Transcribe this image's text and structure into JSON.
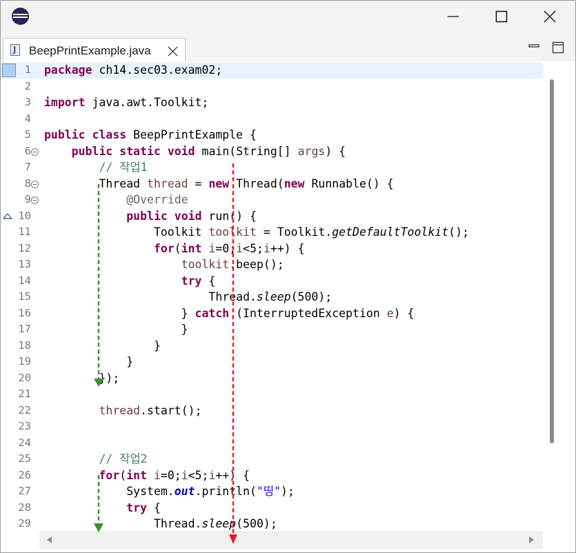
{
  "window": {
    "minimize_icon": "minimize-icon",
    "maximize_icon": "maximize-icon",
    "close_icon": "close-icon"
  },
  "tab": {
    "label": "BeepPrintExample.java",
    "icon": "java-file-icon",
    "close_icon": "close-icon"
  },
  "view_controls": {
    "minimize_icon": "minimize-icon",
    "maximize_icon": "maximize-icon"
  },
  "editor": {
    "current_line": 1,
    "lines": [
      {
        "n": "1",
        "tokens": [
          {
            "t": "package",
            "c": "kw"
          },
          {
            "t": " ch14.sec03.exam02;"
          }
        ]
      },
      {
        "n": "2",
        "tokens": []
      },
      {
        "n": "3",
        "tokens": [
          {
            "t": "import",
            "c": "kw"
          },
          {
            "t": " java.awt.Toolkit;"
          }
        ]
      },
      {
        "n": "4",
        "tokens": []
      },
      {
        "n": "5",
        "tokens": [
          {
            "t": "public",
            "c": "kw"
          },
          {
            "t": " "
          },
          {
            "t": "class",
            "c": "kw"
          },
          {
            "t": " BeepPrintExample {"
          }
        ]
      },
      {
        "n": "6",
        "fold": true,
        "tokens": [
          {
            "t": "    "
          },
          {
            "t": "public",
            "c": "kw"
          },
          {
            "t": " "
          },
          {
            "t": "static",
            "c": "kw"
          },
          {
            "t": " "
          },
          {
            "t": "void",
            "c": "kw"
          },
          {
            "t": " main(String[] "
          },
          {
            "t": "args",
            "c": "va"
          },
          {
            "t": ") {"
          }
        ]
      },
      {
        "n": "7",
        "tokens": [
          {
            "t": "        "
          },
          {
            "t": "// 작업1",
            "c": "cm"
          }
        ]
      },
      {
        "n": "8",
        "fold": true,
        "tokens": [
          {
            "t": "        Thread "
          },
          {
            "t": "thread",
            "c": "va"
          },
          {
            "t": " = "
          },
          {
            "t": "new",
            "c": "kw"
          },
          {
            "t": " Thread("
          },
          {
            "t": "new",
            "c": "kw"
          },
          {
            "t": " Runnable() {"
          }
        ]
      },
      {
        "n": "9",
        "fold": true,
        "tokens": [
          {
            "t": "            "
          },
          {
            "t": "@Override",
            "c": "an"
          }
        ]
      },
      {
        "n": "10",
        "override": true,
        "tokens": [
          {
            "t": "            "
          },
          {
            "t": "public",
            "c": "kw"
          },
          {
            "t": " "
          },
          {
            "t": "void",
            "c": "kw"
          },
          {
            "t": " run() {"
          }
        ]
      },
      {
        "n": "11",
        "tokens": [
          {
            "t": "                Toolkit "
          },
          {
            "t": "toolkit",
            "c": "va"
          },
          {
            "t": " = Toolkit."
          },
          {
            "t": "getDefaultToolkit",
            "c": "it"
          },
          {
            "t": "();"
          }
        ]
      },
      {
        "n": "12",
        "tokens": [
          {
            "t": "                "
          },
          {
            "t": "for",
            "c": "kw"
          },
          {
            "t": "("
          },
          {
            "t": "int",
            "c": "kw"
          },
          {
            "t": " "
          },
          {
            "t": "i",
            "c": "va"
          },
          {
            "t": "=0;"
          },
          {
            "t": "i",
            "c": "va"
          },
          {
            "t": "<5;"
          },
          {
            "t": "i",
            "c": "va"
          },
          {
            "t": "++) {"
          }
        ]
      },
      {
        "n": "13",
        "tokens": [
          {
            "t": "                    "
          },
          {
            "t": "toolkit",
            "c": "va"
          },
          {
            "t": ".beep();"
          }
        ]
      },
      {
        "n": "14",
        "tokens": [
          {
            "t": "                    "
          },
          {
            "t": "try",
            "c": "kw"
          },
          {
            "t": " {"
          }
        ]
      },
      {
        "n": "15",
        "tokens": [
          {
            "t": "                        Thread."
          },
          {
            "t": "sleep",
            "c": "it"
          },
          {
            "t": "(500);"
          }
        ]
      },
      {
        "n": "16",
        "tokens": [
          {
            "t": "                    } "
          },
          {
            "t": "catch",
            "c": "kw"
          },
          {
            "t": " (InterruptedException "
          },
          {
            "t": "e",
            "c": "va"
          },
          {
            "t": ") {"
          }
        ]
      },
      {
        "n": "17",
        "tokens": [
          {
            "t": "                    }"
          }
        ]
      },
      {
        "n": "18",
        "tokens": [
          {
            "t": "                }"
          }
        ]
      },
      {
        "n": "19",
        "tokens": [
          {
            "t": "            }"
          }
        ]
      },
      {
        "n": "20",
        "tokens": [
          {
            "t": "        });"
          }
        ]
      },
      {
        "n": "21",
        "tokens": []
      },
      {
        "n": "22",
        "tokens": [
          {
            "t": "        "
          },
          {
            "t": "thread",
            "c": "va"
          },
          {
            "t": ".start();"
          }
        ]
      },
      {
        "n": "23",
        "tokens": []
      },
      {
        "n": "24",
        "tokens": []
      },
      {
        "n": "25",
        "tokens": [
          {
            "t": "        "
          },
          {
            "t": "// 작업2",
            "c": "cm"
          }
        ]
      },
      {
        "n": "26",
        "tokens": [
          {
            "t": "        "
          },
          {
            "t": "for",
            "c": "kw"
          },
          {
            "t": "("
          },
          {
            "t": "int",
            "c": "kw"
          },
          {
            "t": " "
          },
          {
            "t": "i",
            "c": "va"
          },
          {
            "t": "=0;"
          },
          {
            "t": "i",
            "c": "va"
          },
          {
            "t": "<5;"
          },
          {
            "t": "i",
            "c": "va"
          },
          {
            "t": "++) {"
          }
        ]
      },
      {
        "n": "27",
        "tokens": [
          {
            "t": "            System."
          },
          {
            "t": "out",
            "c": "fi"
          },
          {
            "t": ".println("
          },
          {
            "t": "\"띵\"",
            "c": "st"
          },
          {
            "t": ");"
          }
        ]
      },
      {
        "n": "28",
        "tokens": [
          {
            "t": "            "
          },
          {
            "t": "try",
            "c": "kw"
          },
          {
            "t": " {"
          }
        ]
      },
      {
        "n": "29",
        "tokens": [
          {
            "t": "                Thread."
          },
          {
            "t": "sleep",
            "c": "it"
          },
          {
            "t": "(500);"
          }
        ]
      }
    ]
  },
  "annotations": {
    "green_arrow_color": "#3a8f2a",
    "red_arrow_color": "#ee1c1c"
  },
  "colors": {
    "keyword": "#7f0055",
    "comment": "#3f7f5f",
    "annotation": "#646464",
    "string": "#2a00ff",
    "local_var": "#6a3e3e",
    "current_line": "#e8f2fe"
  }
}
